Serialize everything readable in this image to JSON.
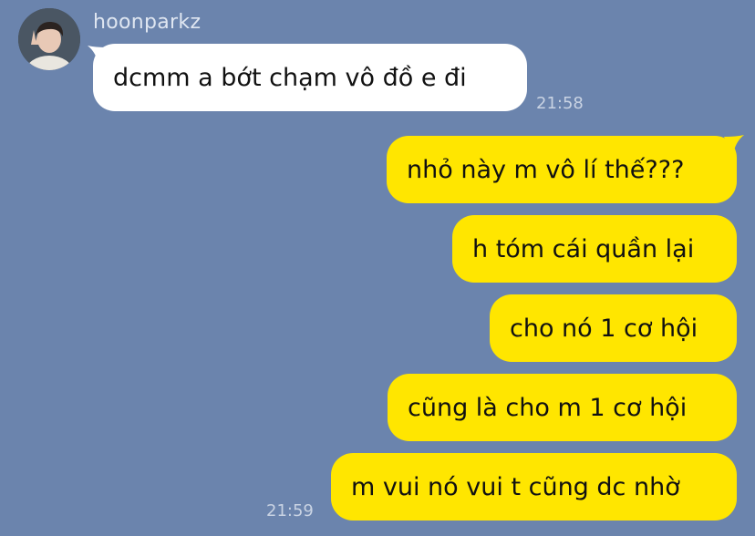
{
  "chat": {
    "sender_name": "hoonparkz",
    "incoming": [
      {
        "text": "dcmm a bớt chạm vô đồ e đi",
        "time": "21:58"
      }
    ],
    "outgoing": [
      {
        "text": "nhỏ này m vô lí thế???"
      },
      {
        "text": "h tóm cái quần lại"
      },
      {
        "text": "cho nó 1 cơ hội"
      },
      {
        "text": "cũng là cho m 1 cơ hội"
      },
      {
        "text": "m vui nó vui t cũng dc nhờ"
      }
    ],
    "outgoing_time": "21:59"
  },
  "colors": {
    "background": "#6b84ad",
    "incoming_bubble": "#ffffff",
    "outgoing_bubble": "#ffe600"
  }
}
